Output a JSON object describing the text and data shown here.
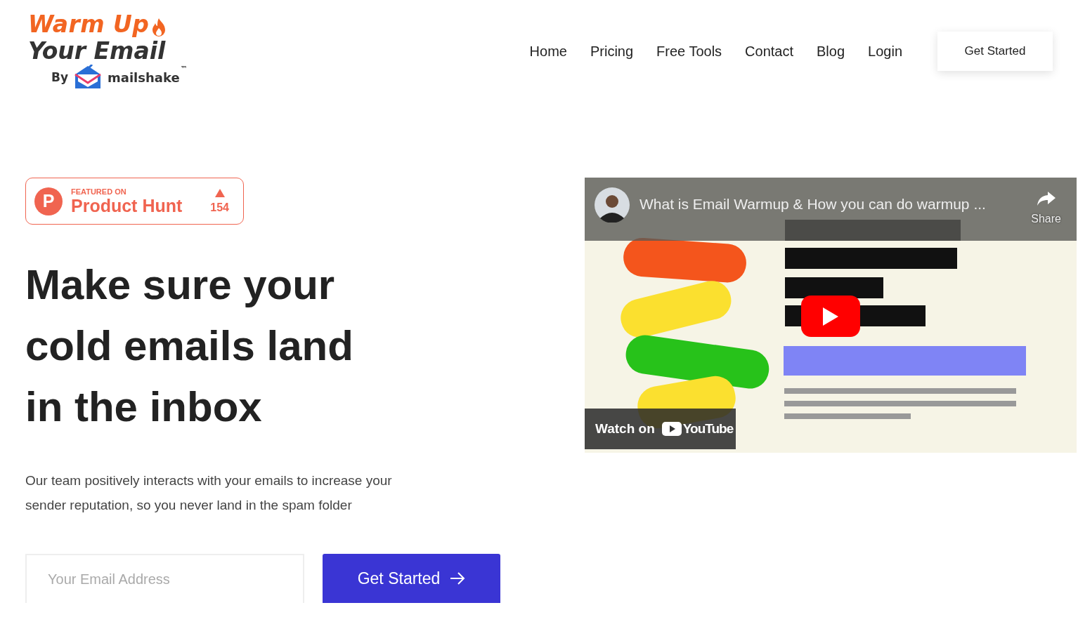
{
  "logo": {
    "line_1": "Warm Up",
    "line_2": "Your Email",
    "by": "By",
    "brand": "mailshake",
    "trademark": "™"
  },
  "nav": {
    "links": [
      {
        "label": "Home"
      },
      {
        "label": "Pricing"
      },
      {
        "label": "Free Tools"
      },
      {
        "label": "Contact"
      },
      {
        "label": "Blog"
      },
      {
        "label": "Login"
      }
    ],
    "button": "Get Started"
  },
  "badge": {
    "letter": "P",
    "caption": "FEATURED ON",
    "name": "Product Hunt",
    "votes": "154"
  },
  "hero": {
    "headline_lines": [
      "Make sure your",
      "cold emails land",
      "in the inbox"
    ],
    "subtext": "Our team positively interacts with your emails to increase your sender reputation, so you never land in the spam folder"
  },
  "signup": {
    "placeholder": "Your Email Address",
    "button": "Get Started"
  },
  "video": {
    "kind": "picture",
    "title": "What is Email Warmup & How you can do warmup ...",
    "share": "Share",
    "watch_on": "Watch on",
    "platform": "YouTube"
  }
}
